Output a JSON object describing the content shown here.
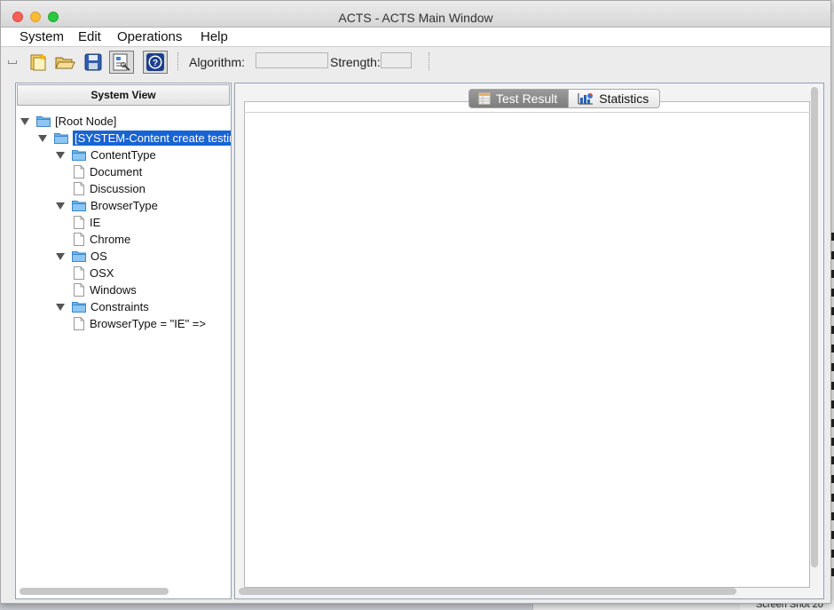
{
  "window": {
    "title": "ACTS - ACTS Main Window"
  },
  "menu": [
    {
      "label": "System"
    },
    {
      "label": "Edit"
    },
    {
      "label": "Operations"
    },
    {
      "label": "Help"
    }
  ],
  "toolbar": {
    "algorithm_label": "Algorithm:",
    "algorithm_value": "",
    "strength_label": "Strength:",
    "strength_value": "",
    "buttons": [
      "new-system-icon",
      "open-icon",
      "save-icon",
      "build-icon",
      "help-icon"
    ]
  },
  "system_view": {
    "header": "System View",
    "tree": [
      {
        "label": "[Root Node]",
        "type": "folder",
        "level": 0,
        "expanded": true
      },
      {
        "label": "[SYSTEM-Content create testing",
        "type": "folder",
        "level": 1,
        "expanded": true,
        "selected": true
      },
      {
        "label": "ContentType",
        "type": "folder",
        "level": 2,
        "expanded": true
      },
      {
        "label": "Document",
        "type": "leaf",
        "level": 3
      },
      {
        "label": "Discussion",
        "type": "leaf",
        "level": 3
      },
      {
        "label": "BrowserType",
        "type": "folder",
        "level": 2,
        "expanded": true
      },
      {
        "label": "IE",
        "type": "leaf",
        "level": 3
      },
      {
        "label": "Chrome",
        "type": "leaf",
        "level": 3
      },
      {
        "label": "OS",
        "type": "folder",
        "level": 2,
        "expanded": true
      },
      {
        "label": "OSX",
        "type": "leaf",
        "level": 3
      },
      {
        "label": "Windows",
        "type": "leaf",
        "level": 3
      },
      {
        "label": "Constraints",
        "type": "folder",
        "level": 2,
        "expanded": true
      },
      {
        "label": "BrowserType = \"IE\" =>",
        "type": "leaf",
        "level": 3
      }
    ]
  },
  "tabs": [
    {
      "label": "Test Result",
      "active": true,
      "icon": "table-icon"
    },
    {
      "label": "Statistics",
      "active": false,
      "icon": "bar-chart-icon"
    }
  ],
  "background": {
    "caption": "Screen Shot 20"
  },
  "colors": {
    "selection": "#1764d2",
    "folder": "#5aa9e6",
    "panel_border": "#8fa2b8"
  }
}
